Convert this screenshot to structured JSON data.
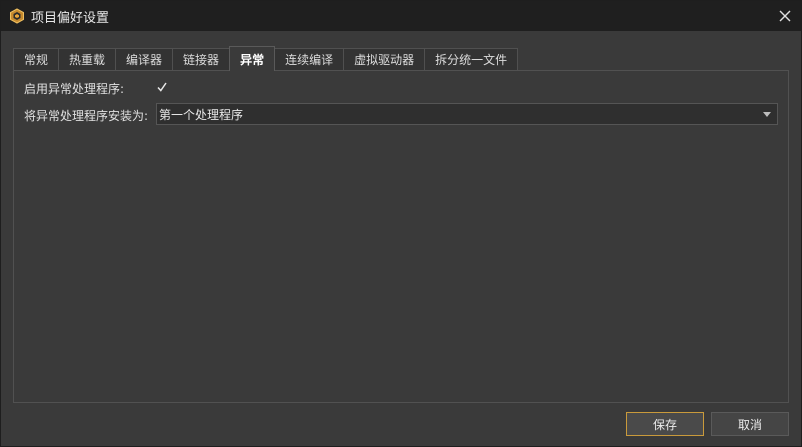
{
  "window": {
    "title": "项目偏好设置",
    "accent_color": "#c99a3b"
  },
  "tabs": [
    {
      "label": "常规",
      "active": false
    },
    {
      "label": "热重载",
      "active": false
    },
    {
      "label": "编译器",
      "active": false
    },
    {
      "label": "链接器",
      "active": false
    },
    {
      "label": "异常",
      "active": true
    },
    {
      "label": "连续编译",
      "active": false
    },
    {
      "label": "虚拟驱动器",
      "active": false
    },
    {
      "label": "拆分统一文件",
      "active": false
    }
  ],
  "settings": {
    "enable_label": "启用异常处理程序:",
    "enable_checked": true,
    "install_label": "将异常处理程序安装为:",
    "install_value": "第一个处理程序"
  },
  "buttons": {
    "save": "保存",
    "cancel": "取消"
  },
  "icons": {
    "app": "hex-app-icon",
    "close": "close-icon",
    "check": "checkmark-icon",
    "dropdown": "chevron-down-icon"
  }
}
